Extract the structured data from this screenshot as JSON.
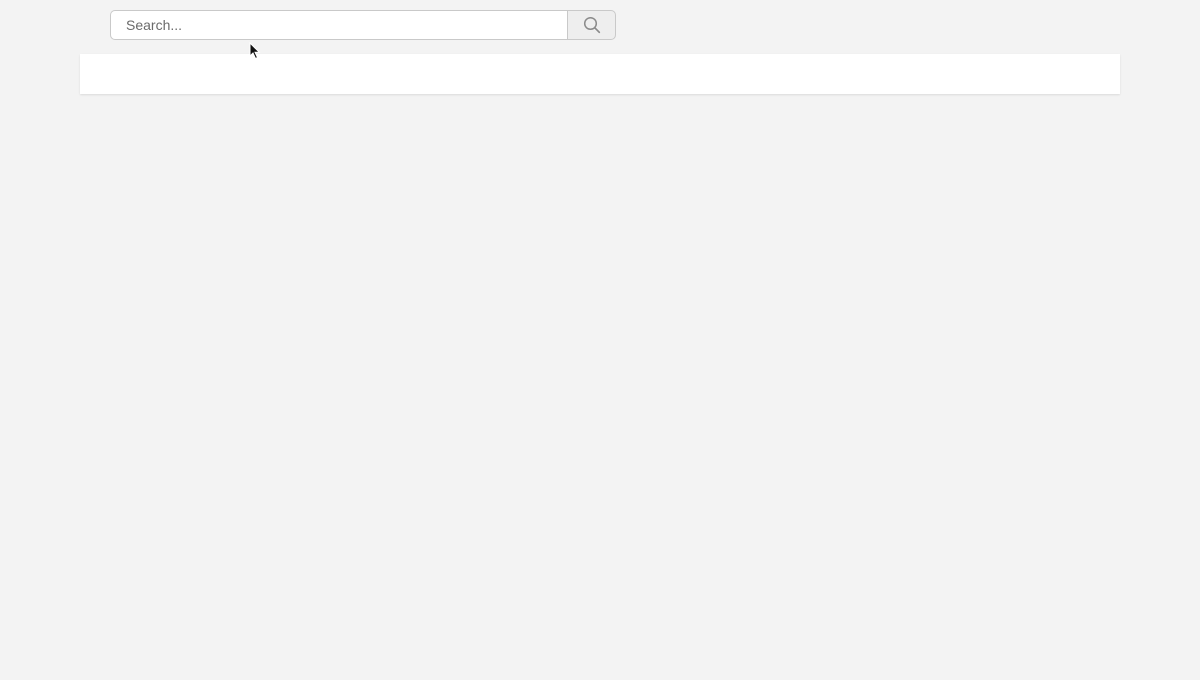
{
  "search": {
    "placeholder": "Search...",
    "value": "",
    "button_icon": "search-icon"
  },
  "colors": {
    "background": "#f3f3f3",
    "panel": "#ffffff",
    "border": "#c9c9c9",
    "button_bg": "#eeeeee",
    "icon": "#8a8a8a"
  },
  "main": {
    "panel_content": ""
  }
}
